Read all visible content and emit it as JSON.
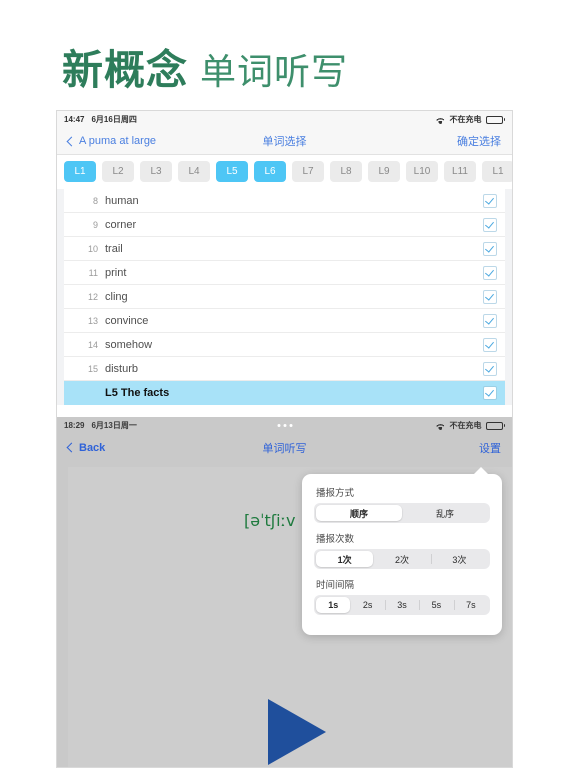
{
  "header": {
    "title_strong": "新概念",
    "title_light": "单词听写"
  },
  "screenshot_top": {
    "status_bar": {
      "time": "14:47",
      "date": "6月16日周四",
      "wifi_icon": "wifi-icon",
      "charging_text": "不在充电",
      "battery_icon": "battery-icon"
    },
    "nav": {
      "back_label": "A puma at large",
      "back_icon": "chevron-left-icon",
      "title": "单词选择",
      "right_action": "确定选择"
    },
    "lessons": [
      {
        "label": "L1",
        "selected": true
      },
      {
        "label": "L2",
        "selected": false
      },
      {
        "label": "L3",
        "selected": false
      },
      {
        "label": "L4",
        "selected": false
      },
      {
        "label": "L5",
        "selected": true
      },
      {
        "label": "L6",
        "selected": true
      },
      {
        "label": "L7",
        "selected": false
      },
      {
        "label": "L8",
        "selected": false
      },
      {
        "label": "L9",
        "selected": false
      },
      {
        "label": "L10",
        "selected": false
      },
      {
        "label": "L11",
        "selected": false
      },
      {
        "label": "L1",
        "selected": false
      }
    ],
    "words": [
      {
        "num": "8",
        "text": "human",
        "checked": true,
        "section": false
      },
      {
        "num": "9",
        "text": "corner",
        "checked": true,
        "section": false
      },
      {
        "num": "10",
        "text": "trail",
        "checked": true,
        "section": false
      },
      {
        "num": "11",
        "text": "print",
        "checked": true,
        "section": false
      },
      {
        "num": "12",
        "text": "cling",
        "checked": true,
        "section": false
      },
      {
        "num": "13",
        "text": "convince",
        "checked": true,
        "section": false
      },
      {
        "num": "14",
        "text": "somehow",
        "checked": true,
        "section": false
      },
      {
        "num": "15",
        "text": "disturb",
        "checked": true,
        "section": false
      },
      {
        "num": "",
        "text": "L5  The facts",
        "checked": true,
        "section": true
      }
    ]
  },
  "screenshot_bottom": {
    "status_bar": {
      "time": "18:29",
      "date": "6月13日周一",
      "wifi_icon": "wifi-icon",
      "charging_text": "不在充电",
      "battery_icon": "battery-icon",
      "handle_dots": "multitask-dots-icon"
    },
    "nav": {
      "back_label": "Back",
      "back_icon": "chevron-left-icon",
      "title": "单词听写",
      "right_action": "设置"
    },
    "content": {
      "phonetic": "[əˈtʃiːv",
      "play_icon": "play-triangle-icon"
    },
    "popover": {
      "groups": [
        {
          "label": "播报方式",
          "options": [
            {
              "label": "顺序",
              "selected": true
            },
            {
              "label": "乱序",
              "selected": false
            }
          ]
        },
        {
          "label": "播报次数",
          "options": [
            {
              "label": "1次",
              "selected": true
            },
            {
              "label": "2次",
              "selected": false
            },
            {
              "label": "3次",
              "selected": false
            }
          ]
        },
        {
          "label": "时间间隔",
          "options": [
            {
              "label": "1s",
              "selected": true
            },
            {
              "label": "2s",
              "selected": false
            },
            {
              "label": "3s",
              "selected": false
            },
            {
              "label": "5s",
              "selected": false
            },
            {
              "label": "7s",
              "selected": false
            }
          ]
        }
      ]
    }
  },
  "colors": {
    "brand_green": "#2e7d5b",
    "accent_blue": "#4ec6f5",
    "nav_blue": "#4a7fe0",
    "section_blue": "#a8e2f8",
    "play_blue": "#1f4f9c",
    "phonetic_green": "#1e7a3e"
  }
}
